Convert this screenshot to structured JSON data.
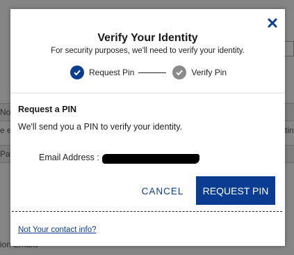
{
  "background": {
    "row1_left": "Not",
    "row1_left2": "e e",
    "row1_right": "tin",
    "row2_left": "Pa",
    "bottom_text": "ion Emails"
  },
  "modal": {
    "title": "Verify Your Identity",
    "subtitle": "For security purposes, we'll need to verify your identity.",
    "close_icon": "close-icon",
    "stepper": {
      "steps": [
        {
          "label": "Request Pin",
          "state": "completed",
          "icon": "check-circle-icon"
        },
        {
          "label": "Verify Pin",
          "state": "pending",
          "icon": "check-circle-icon"
        }
      ]
    },
    "section": {
      "heading": "Request a PIN",
      "description": "We'll send you a PIN to verify your identity."
    },
    "email": {
      "label": "Email Address :"
    },
    "actions": {
      "cancel_label": "CANCEL",
      "request_label": "REQUEST PIN"
    },
    "footer": {
      "link_label": "Not Your contact info?"
    },
    "colors": {
      "primary": "#0a3d91",
      "inactive_step": "#8a8a8a",
      "overlay": "#7f7f7f"
    }
  }
}
